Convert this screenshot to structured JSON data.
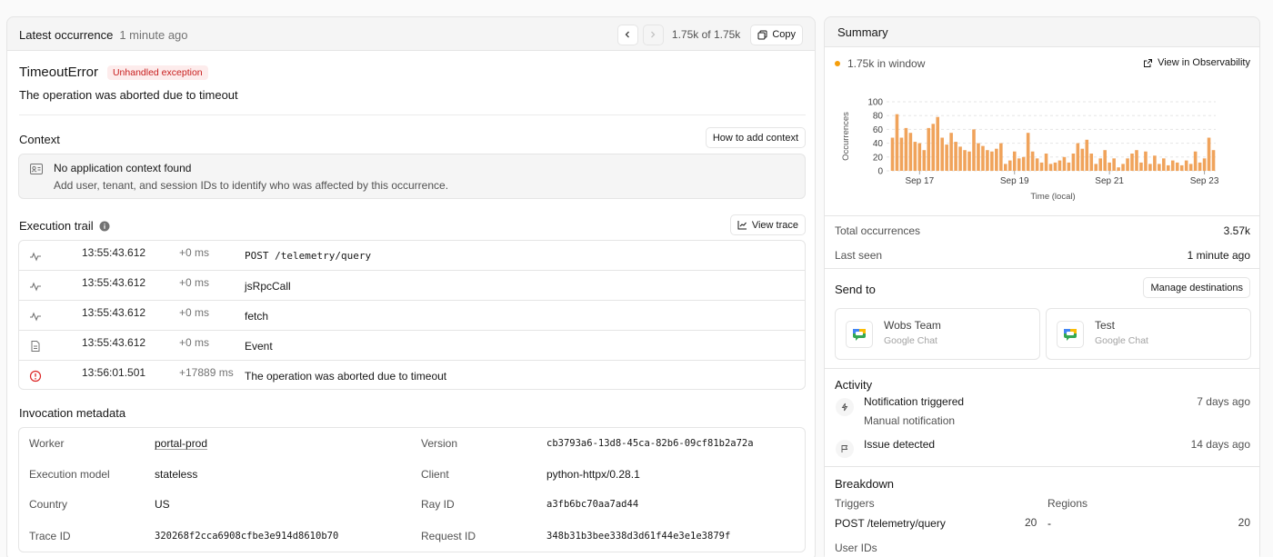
{
  "latest": {
    "title": "Latest occurrence",
    "ago": "1 minute ago",
    "counter": "1.75k of 1.75k",
    "copy_label": "Copy"
  },
  "error": {
    "name": "TimeoutError",
    "badge": "Unhandled exception",
    "message": "The operation was aborted due to timeout"
  },
  "context": {
    "title": "Context",
    "how_button": "How to add context",
    "empty_title": "No application context found",
    "empty_desc": "Add user, tenant, and session IDs to identify who was affected by this occurrence."
  },
  "trail": {
    "title": "Execution trail",
    "view_trace": "View trace",
    "rows": [
      {
        "icon": "activity-icon",
        "time": "13:55:43.612",
        "delta": "+0 ms",
        "label": "POST /telemetry/query",
        "mono": true
      },
      {
        "icon": "activity-icon",
        "time": "13:55:43.612",
        "delta": "+0 ms",
        "label": "jsRpcCall",
        "mono": false
      },
      {
        "icon": "activity-icon",
        "time": "13:55:43.612",
        "delta": "+0 ms",
        "label": "fetch",
        "mono": false
      },
      {
        "icon": "file-icon",
        "time": "13:55:43.612",
        "delta": "+0 ms",
        "label": "Event",
        "mono": false
      },
      {
        "icon": "alert-circle-icon",
        "time": "13:56:01.501",
        "delta": "+17889 ms",
        "label": "The operation was aborted due to timeout",
        "mono": false
      }
    ]
  },
  "metadata": {
    "title": "Invocation metadata",
    "worker_k": "Worker",
    "worker_v": "portal-prod",
    "version_k": "Version",
    "version_v": "cb3793a6-13d8-45ca-82b6-09cf81b2a72a",
    "model_k": "Execution model",
    "model_v": "stateless",
    "client_k": "Client",
    "client_v": "python-httpx/0.28.1",
    "country_k": "Country",
    "country_v": "US",
    "ray_k": "Ray ID",
    "ray_v": "a3fb6bc70aa7ad44",
    "trace_k": "Trace ID",
    "trace_v": "320268f2cca6908cfbe3e914d8610b70",
    "request_k": "Request ID",
    "request_v": "348b31b3bee338d3d61f44e3e1e3879f"
  },
  "summary": {
    "title": "Summary",
    "window": "1.75k in window",
    "observability_link": "View in Observability",
    "total_k": "Total occurrences",
    "total_v": "3.57k",
    "last_k": "Last seen",
    "last_v": "1 minute ago",
    "send_to": "Send to",
    "manage": "Manage destinations",
    "destinations": [
      {
        "name": "Wobs Team",
        "type": "Google Chat"
      },
      {
        "name": "Test",
        "type": "Google Chat"
      }
    ],
    "activity_title": "Activity",
    "activity": [
      {
        "title": "Notification triggered",
        "sub": "Manual notification",
        "time": "7 days ago",
        "icon": "zap-icon"
      },
      {
        "title": "Issue detected",
        "sub": "",
        "time": "14 days ago",
        "icon": "flag-icon"
      }
    ],
    "breakdown_title": "Breakdown",
    "triggers_label": "Triggers",
    "trigger_name": "POST /telemetry/query",
    "trigger_count": "20",
    "regions_label": "Regions",
    "region_name": "-",
    "region_count": "20",
    "user_ids_label": "User IDs"
  },
  "colors": {
    "bar": "#f0a35b",
    "accent": "#f59e0b",
    "danger": "#dc2626"
  },
  "chart_data": {
    "type": "bar",
    "xlabel": "Time (local)",
    "ylabel": "Occurrences",
    "ylim": [
      0,
      100
    ],
    "yticks": [
      0,
      20,
      40,
      60,
      80,
      100
    ],
    "xtick_labels": [
      "Sep 17",
      "Sep 19",
      "Sep 21",
      "Sep 23"
    ],
    "xtick_index": [
      6,
      27,
      48,
      69
    ],
    "values": [
      48,
      82,
      48,
      62,
      55,
      42,
      40,
      30,
      62,
      68,
      78,
      48,
      38,
      55,
      42,
      35,
      30,
      28,
      60,
      40,
      36,
      30,
      28,
      32,
      40,
      10,
      15,
      28,
      18,
      20,
      55,
      28,
      18,
      12,
      25,
      10,
      12,
      15,
      20,
      12,
      25,
      40,
      32,
      45,
      25,
      10,
      18,
      30,
      12,
      18,
      5,
      10,
      18,
      25,
      30,
      12,
      28,
      10,
      22,
      10,
      18,
      8,
      15,
      12,
      8,
      15,
      10,
      28,
      12,
      18,
      48,
      30
    ],
    "grid": true
  }
}
